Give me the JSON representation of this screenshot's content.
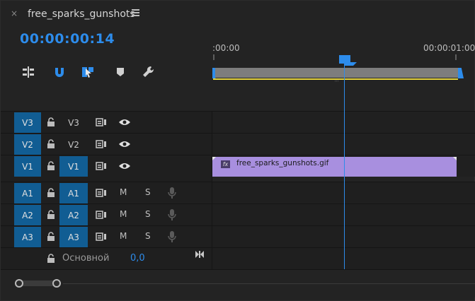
{
  "tab": {
    "close_glyph": "×",
    "title": "free_sparks_gunshots",
    "menu_icon": "hamburger-menu-icon"
  },
  "timecode": "00:00:00:14",
  "tools": [
    {
      "name": "insert-edits-icon"
    },
    {
      "name": "snap-magnet-icon"
    },
    {
      "name": "linked-selection-icon"
    },
    {
      "name": "add-marker-icon"
    },
    {
      "name": "timeline-settings-wrench-icon"
    }
  ],
  "ruler": {
    "start_label": ":00:00",
    "end_label": "00:00:01:00"
  },
  "tracks": [
    {
      "id": "v3",
      "target": "V3",
      "source": "V3",
      "target_on": true,
      "source_on": false,
      "kind": "video"
    },
    {
      "id": "v2",
      "target": "V2",
      "source": "V2",
      "target_on": true,
      "source_on": false,
      "kind": "video"
    },
    {
      "id": "v1",
      "target": "V1",
      "source": "V1",
      "target_on": true,
      "source_on": true,
      "kind": "video"
    },
    {
      "id": "a1",
      "target": "A1",
      "source": "A1",
      "target_on": true,
      "source_on": true,
      "kind": "audio"
    },
    {
      "id": "a2",
      "target": "A2",
      "source": "A2",
      "target_on": true,
      "source_on": true,
      "kind": "audio"
    },
    {
      "id": "a3",
      "target": "A3",
      "source": "A3",
      "target_on": true,
      "source_on": true,
      "kind": "audio"
    }
  ],
  "audio_buttons": {
    "mute": "M",
    "solo": "S"
  },
  "clip": {
    "fx_label": "fx",
    "name": "free_sparks_gunshots.gif",
    "color": "#a88fdf"
  },
  "master": {
    "label": "Основной",
    "value": "0,0"
  },
  "colors": {
    "accent": "#2d8ceb",
    "track_target": "#115d93",
    "work_area_yellow": "#e5d33d"
  }
}
